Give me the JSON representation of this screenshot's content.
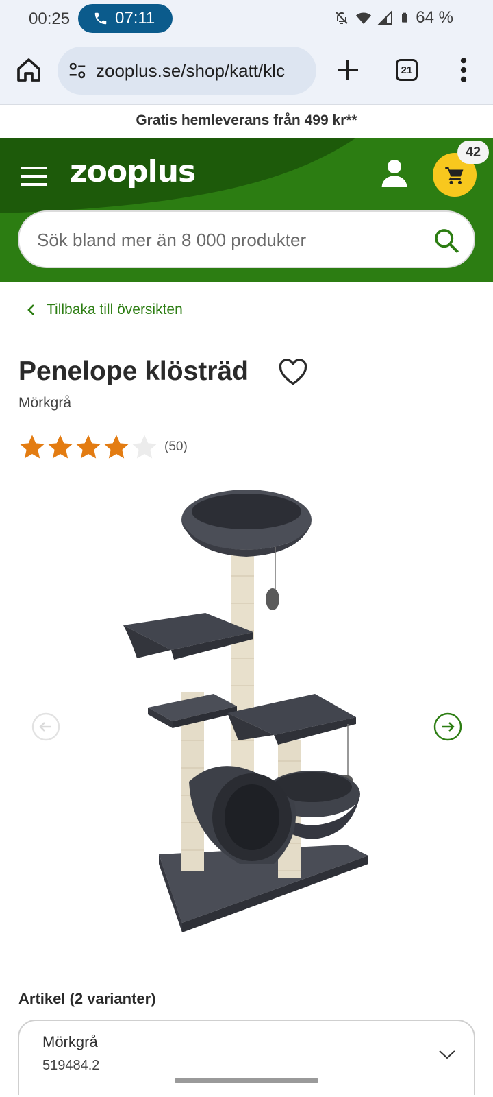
{
  "status_bar": {
    "time": "00:25",
    "call_duration": "07:11",
    "battery": "64 %"
  },
  "browser": {
    "url": "zooplus.se/shop/katt/klc",
    "tab_count": "21"
  },
  "promo": {
    "text": "Gratis hemleverans från 499 kr**"
  },
  "header": {
    "logo": "zooplus",
    "cart_count": "42",
    "search_placeholder": "Sök bland mer än 8 000 produkter"
  },
  "product": {
    "back_label": "Tillbaka till översikten",
    "title": "Penelope klösträd",
    "variant_label": "Mörkgrå",
    "rating_value": 4,
    "rating_max": 5,
    "review_count": "(50)"
  },
  "variants": {
    "heading": "Artikel (2 varianter)",
    "selected_name": "Mörkgrå",
    "selected_code": "519484.2"
  },
  "colors": {
    "brand_green": "#2c7d12",
    "header_dark": "#1d5a0a",
    "cart_yellow": "#f8c81e",
    "star_orange": "#e37c12"
  }
}
